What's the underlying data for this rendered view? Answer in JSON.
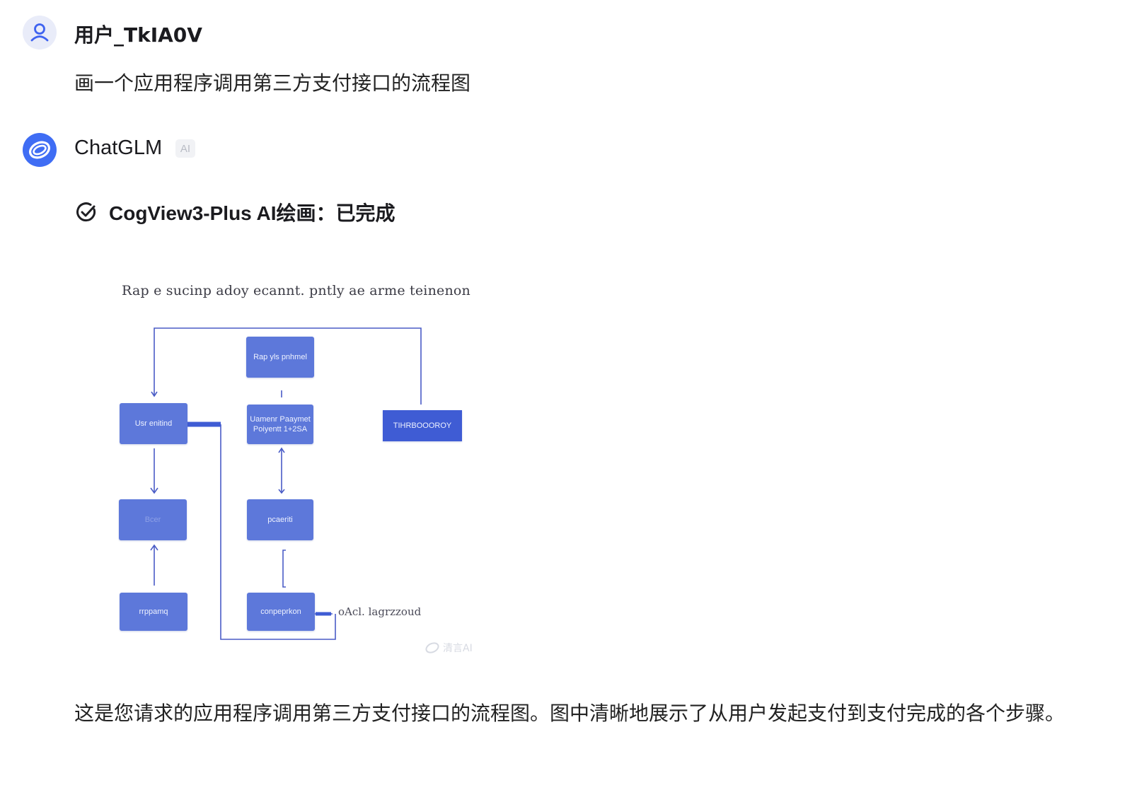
{
  "user": {
    "name": "用户_TkIA0V",
    "message": "画一个应用程序调用第三方支付接口的流程图",
    "avatar_icon": "user-icon"
  },
  "assistant": {
    "name": "ChatGLM",
    "badge": "AI",
    "avatar_icon": "chatglm-logo-icon",
    "tool_status_icon": "check-circle-icon",
    "tool_status": "CogView3-Plus AI绘画：已完成",
    "reply": "这是您请求的应用程序调用第三方支付接口的流程图。图中清晰地展示了从用户发起支付到支付完成的各个步骤。"
  },
  "generated_image": {
    "caption": "Rap e sucinp adoy ecannt. pntly ae arme teinenon",
    "boxes": {
      "top": "Rap yls pnhmel",
      "user": "Usr enitind",
      "middle": "Uamenr Paaymet Poiyentt 1+2SA",
      "right": "TIHRBOOOROY",
      "left_mid": "Bcer",
      "center_mid": "pcaeriti",
      "left_bottom": "rrppamq",
      "center_bottom": "conpeprkon"
    },
    "note": "oAcl. lagrzzoud",
    "watermark": "清言AI"
  },
  "colors": {
    "accent": "#3f6df4",
    "box": "#5d78da",
    "box_dark": "#3f5cd4",
    "line": "#4a5cc6"
  }
}
